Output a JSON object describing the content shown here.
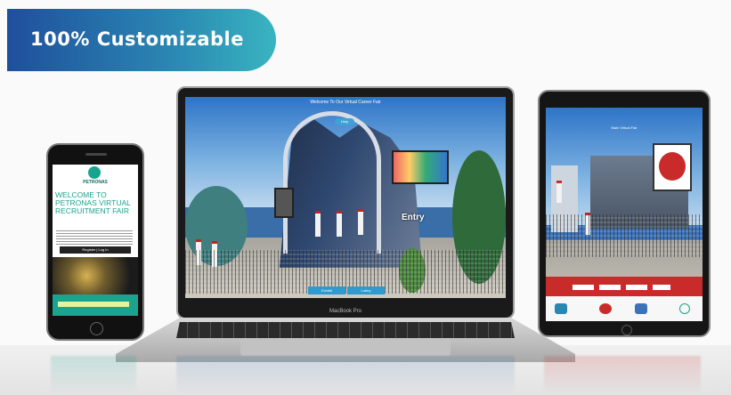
{
  "banner": {
    "title": "100% Customizable"
  },
  "phone": {
    "brand": "PETRONAS",
    "welcome": "WELCOME TO PETRONAS VIRTUAL RECRUITMENT FAIR",
    "register_button": "Register | Log In"
  },
  "laptop": {
    "brand": "MacBook Pro",
    "scene_title": "Entry",
    "top_title": "Welcome To Our Virtual Career Fair",
    "top_pill": "Help",
    "tabs": [
      "Exhibit",
      "Lobby"
    ]
  },
  "tablet": {
    "header_label": "Main Virtual Fair"
  },
  "colors": {
    "banner_start": "#1f4f9c",
    "banner_end": "#39b4c1",
    "phone_accent": "#1aa38f",
    "tablet_accent": "#c92b2b"
  }
}
